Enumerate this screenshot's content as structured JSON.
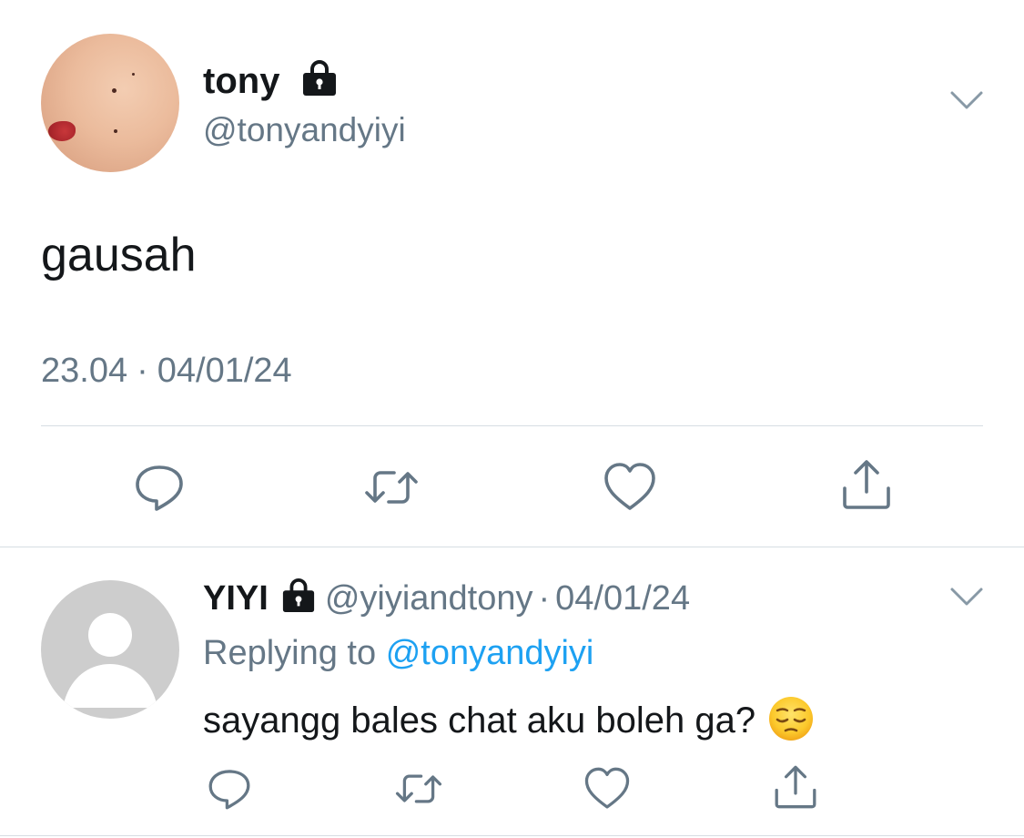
{
  "main_tweet": {
    "display_name": "tony",
    "handle": "@tonyandyiyi",
    "text": "gausah",
    "time": "23.04",
    "separator": "·",
    "date": "04/01/24",
    "locked": true
  },
  "reply": {
    "display_name": "YIYI",
    "handle": "@yiyiandtony",
    "separator": "·",
    "date": "04/01/24",
    "replying_prefix": "Replying to",
    "replying_to": "@tonyandyiyi",
    "text": "sayangg bales chat aku boleh ga?",
    "emoji": "pensive-face",
    "locked": true
  },
  "icons": {
    "reply": "reply-icon",
    "retweet": "retweet-icon",
    "like": "heart-icon",
    "share": "share-icon",
    "more": "chevron-down-icon",
    "protected": "lock-icon"
  },
  "colors": {
    "text": "#14171a",
    "secondary": "#657786",
    "link": "#1da1f2",
    "divider": "#d6dde3"
  }
}
